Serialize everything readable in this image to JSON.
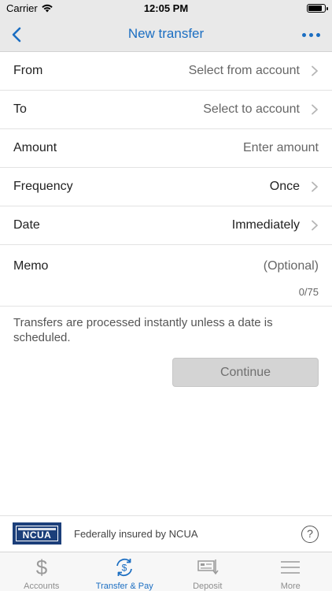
{
  "status_bar": {
    "carrier": "Carrier",
    "time": "12:05 PM"
  },
  "nav": {
    "title": "New transfer",
    "back_icon": "chevron-left-icon",
    "more_icon": "ellipsis-icon"
  },
  "form": {
    "rows": [
      {
        "label": "From",
        "value": "Select from account"
      },
      {
        "label": "To",
        "value": "Select to account"
      },
      {
        "label": "Amount",
        "value": "Enter amount"
      },
      {
        "label": "Frequency",
        "value": "Once"
      },
      {
        "label": "Date",
        "value": "Immediately"
      },
      {
        "label": "Memo",
        "value": "(Optional)",
        "counter": "0/75"
      }
    ]
  },
  "info_text": "Transfers are processed instantly unless a date is scheduled.",
  "continue_label": "Continue",
  "ncua": {
    "logo_text": "NCUA",
    "text": "Federally insured by NCUA",
    "help": "?"
  },
  "tabs": [
    {
      "label": "Accounts",
      "icon": "dollar-icon",
      "active": false
    },
    {
      "label": "Transfer & Pay",
      "icon": "transfer-dollar-icon",
      "active": true
    },
    {
      "label": "Deposit",
      "icon": "check-deposit-icon",
      "active": false
    },
    {
      "label": "More",
      "icon": "hamburger-menu-icon",
      "active": false
    }
  ],
  "colors": {
    "accent": "#1b6ec2",
    "nav_bg": "#e9e9e9",
    "ncua_navy": "#1c3f7a",
    "button_disabled": "#d4d4d4"
  }
}
